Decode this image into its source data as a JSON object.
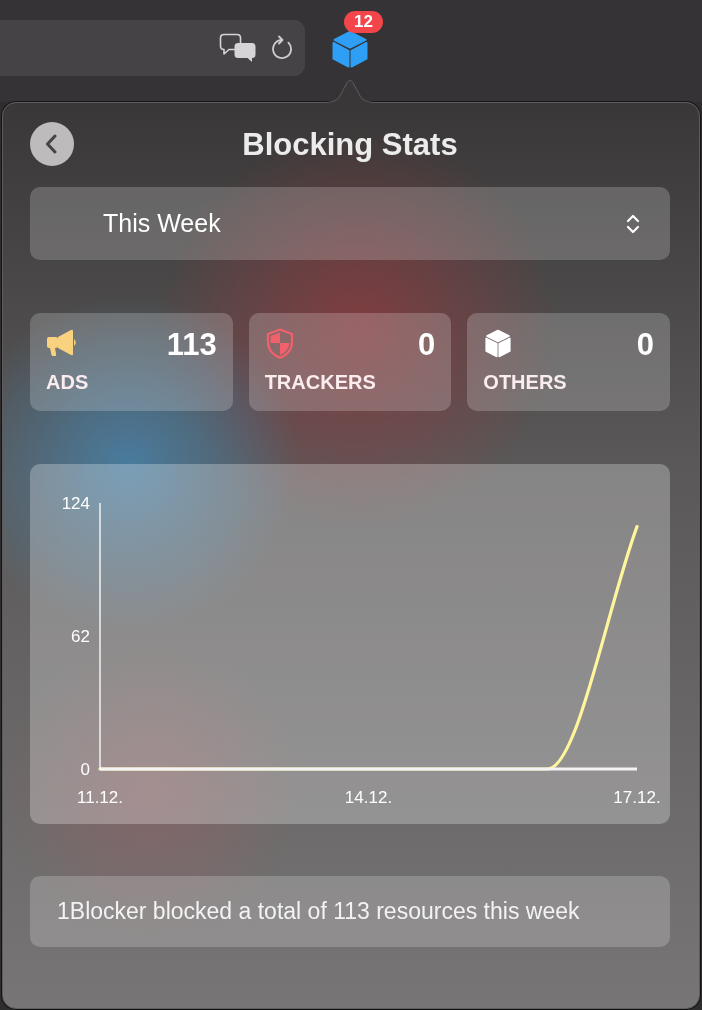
{
  "toolbar": {
    "extension_badge": "12"
  },
  "popover": {
    "title": "Blocking Stats",
    "period_select": {
      "value": "This Week"
    },
    "stats": [
      {
        "kind": "ads",
        "count": "113",
        "label": "ADS",
        "color": "#f8d27e"
      },
      {
        "kind": "trackers",
        "count": "0",
        "label": "TRACKERS",
        "color": "#f0616b"
      },
      {
        "kind": "others",
        "count": "0",
        "label": "OTHERS",
        "color": "#ffffff"
      }
    ],
    "chart": {
      "chart_data": {
        "type": "line",
        "categories": [
          "11.12.",
          null,
          null,
          "14.12.",
          null,
          null,
          "17.12."
        ],
        "ylim": [
          0,
          124
        ],
        "yticks": [
          0,
          62,
          124
        ],
        "series": [
          {
            "color": "#fff59d",
            "values": [
              0,
              0,
              0,
              0,
              0,
              0,
              113
            ]
          }
        ]
      }
    },
    "summary": "1Blocker blocked a total of 113 resources this week"
  }
}
